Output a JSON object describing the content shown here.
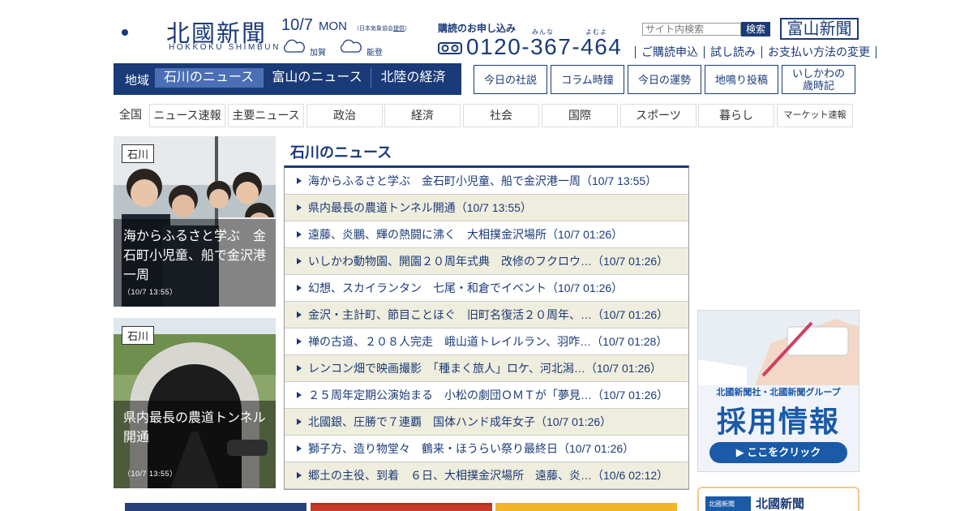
{
  "brand": {
    "name_jp": "北國新聞",
    "name_en": "HOKKOKU SHIMBUN"
  },
  "weather": {
    "date": "10/7",
    "weekday": "MON",
    "source_prefix": "（日本気象協会",
    "source_link": "提供",
    "source_suffix": "）",
    "cities": [
      "加賀",
      "能登"
    ]
  },
  "subscription": {
    "title": "購読のお申し込み",
    "ruby": [
      "みんな",
      "よむよ"
    ],
    "phone": "0120-367-464"
  },
  "search": {
    "placeholder": "サイト内検索",
    "button": "検索"
  },
  "toyama_button": "富山新聞",
  "header_links": [
    "ご購読申込",
    "試し読み",
    "お支払い方法の変更"
  ],
  "region_nav": {
    "label": "地域",
    "tabs": [
      "石川のニュース",
      "富山のニュース",
      "北陸の経済"
    ],
    "active": "石川のニュース"
  },
  "feature_buttons": [
    "今日の社説",
    "コラム時鐘",
    "今日の運勢",
    "地鳴り投稿",
    "いしかわの\n歳時記"
  ],
  "categories": [
    "全国",
    "ニュース速報",
    "主要ニュース",
    "政治",
    "経済",
    "社会",
    "国際",
    "スポーツ",
    "暮らし",
    "マーケット速報"
  ],
  "cards": [
    {
      "tag": "石川",
      "caption": "海からふるさと学ぶ　金石町小児童、船で金沢港一周",
      "time": "（10/7 13:55）"
    },
    {
      "tag": "石川",
      "caption": "県内最長の農道トンネル開通",
      "time": "（10/7 13:55）"
    }
  ],
  "news": {
    "title": "石川のニュース",
    "items": [
      "海からふるさと学ぶ　金石町小児童、船で金沢港一周（10/7 13:55）",
      "県内最長の農道トンネル開通（10/7 13:55）",
      "遠藤、炎鵬、輝の熱闘に沸く　大相撲金沢場所（10/7 01:26）",
      "いしかわ動物園、開園２０周年式典　改修のフクロウ…（10/7 01:26）",
      "幻想、スカイランタン　七尾・和倉でイベント（10/7 01:26）",
      "金沢・主計町、節目ことほぐ　旧町名復活２０周年、…（10/7 01:26）",
      "禅の古道、２０８人完走　峨山道トレイルラン、羽咋…（10/7 01:28）",
      "レンコン畑で映画撮影　「種まく旅人」ロケ、河北潟…（10/7 01:26）",
      "２５周年定期公演始まる　小松の劇団ＯＭＴが「夢見…（10/7 01:26）",
      "北國銀、圧勝で７連覇　国体ハンド成年女子（10/7 01:26）",
      "獅子方、造り物堂々　鶴来・ほうらい祭り最終日（10/7 01:26）",
      "郷土の主役、到着　６日、大相撲金沢場所　遠藤、炎…（10/6 02:12）"
    ]
  },
  "banner": {
    "subtitle": "北國新聞社・北國新聞グループ",
    "title": "採用情報",
    "button": "▶ ここをクリック"
  },
  "promo2": {
    "logo": "北國新聞",
    "name": "北國新聞"
  },
  "colors": {
    "brand": "#1a3a78",
    "active_tab": "#4a6fb5",
    "row_alt": "#efeddd",
    "banner_blue": "#1a5aa8"
  }
}
